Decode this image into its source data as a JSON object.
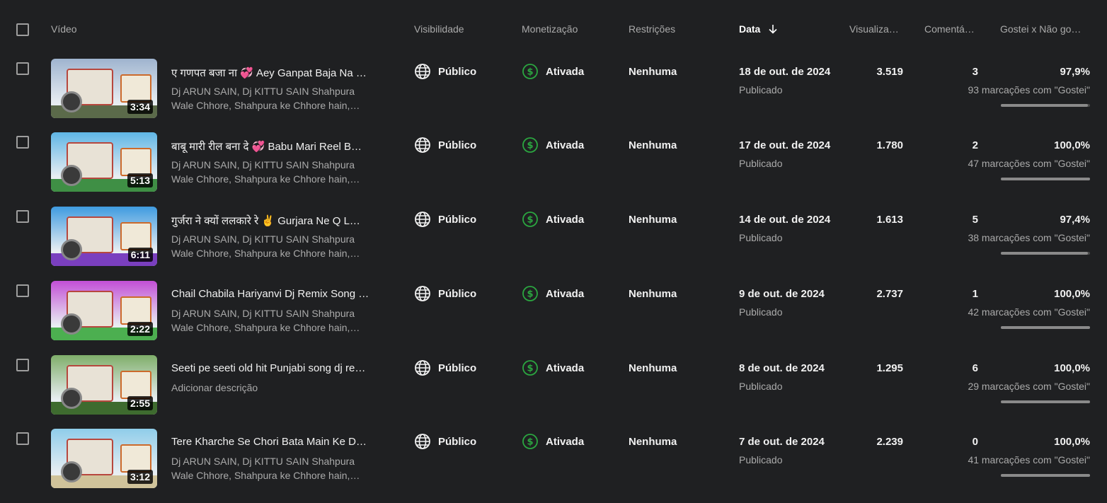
{
  "colors": {
    "background": "#1f2022",
    "text_primary": "#f1f1f1",
    "text_secondary": "#aaaaaa",
    "monetization_icon": "#2ba640"
  },
  "header": {
    "video": "Vídeo",
    "visibility": "Visibilidade",
    "monetization": "Monetização",
    "restrictions": "Restrições",
    "date": "Data",
    "views": "Visualiza…",
    "comments": "Comentá…",
    "likes": "Gostei x Não go…",
    "sort_icon": "arrow-down-icon"
  },
  "rows": [
    {
      "duration": "3:34",
      "title": "ए गणपत बजा ना 💞 Aey Ganpat Baja Na …",
      "desc1": "Dj ARUN SAIN, Dj KITTU SAIN Shahpura",
      "desc2": "Wale Chhore, Shahpura ke Chhore hain,…",
      "visibility": "Público",
      "monetization": "Ativada",
      "restrictions": "Nenhuma",
      "date": "18 de out. de 2024",
      "status": "Publicado",
      "views": "3.519",
      "comments": "3",
      "likes_pct": "97,9%",
      "likes_count": "93 marcações com \"Gostei\"",
      "like_ratio": 0.979,
      "thumb_sky": "#9fb4cf",
      "thumb_ground": "#5b6a4a"
    },
    {
      "duration": "5:13",
      "title": "बाबू मारी रील बना दे 💞 Babu Mari Reel B…",
      "desc1": "Dj ARUN SAIN, Dj KITTU SAIN Shahpura",
      "desc2": "Wale Chhore, Shahpura ke Chhore hain,…",
      "visibility": "Público",
      "monetization": "Ativada",
      "restrictions": "Nenhuma",
      "date": "17 de out. de 2024",
      "status": "Publicado",
      "views": "1.780",
      "comments": "2",
      "likes_pct": "100,0%",
      "likes_count": "47 marcações com \"Gostei\"",
      "like_ratio": 1.0,
      "thumb_sky": "#5fb6e6",
      "thumb_ground": "#3f8f45"
    },
    {
      "duration": "6:11",
      "title": "गुर्जरा ने क्यों ललकारे रे ✌️ Gurjara Ne Q L…",
      "desc1": "Dj ARUN SAIN, Dj KITTU SAIN Shahpura",
      "desc2": "Wale Chhore, Shahpura ke Chhore hain,…",
      "visibility": "Público",
      "monetization": "Ativada",
      "restrictions": "Nenhuma",
      "date": "14 de out. de 2024",
      "status": "Publicado",
      "views": "1.613",
      "comments": "5",
      "likes_pct": "97,4%",
      "likes_count": "38 marcações com \"Gostei\"",
      "like_ratio": 0.974,
      "thumb_sky": "#3f9be0",
      "thumb_ground": "#7a3fbf"
    },
    {
      "duration": "2:22",
      "title": "Chail Chabila Hariyanvi Dj Remix Song …",
      "desc1": "Dj ARUN SAIN, Dj KITTU SAIN Shahpura",
      "desc2": "Wale Chhore, Shahpura ke Chhore hain,…",
      "visibility": "Público",
      "monetization": "Ativada",
      "restrictions": "Nenhuma",
      "date": "9 de out. de 2024",
      "status": "Publicado",
      "views": "2.737",
      "comments": "1",
      "likes_pct": "100,0%",
      "likes_count": "42 marcações com \"Gostei\"",
      "like_ratio": 1.0,
      "thumb_sky": "#c24fd6",
      "thumb_ground": "#4caf50"
    },
    {
      "duration": "2:55",
      "title": "Seeti pe seeti old hit Punjabi song dj re…",
      "desc1": "Adicionar descrição",
      "desc2": "",
      "visibility": "Público",
      "monetization": "Ativada",
      "restrictions": "Nenhuma",
      "date": "8 de out. de 2024",
      "status": "Publicado",
      "views": "1.295",
      "comments": "6",
      "likes_pct": "100,0%",
      "likes_count": "29 marcações com \"Gostei\"",
      "like_ratio": 1.0,
      "thumb_sky": "#7fae6a",
      "thumb_ground": "#3e6b2f"
    },
    {
      "duration": "3:12",
      "title": "Tere Kharche Se Chori Bata Main Ke D…",
      "desc1": "Dj ARUN SAIN, Dj KITTU SAIN Shahpura",
      "desc2": "Wale Chhore, Shahpura ke Chhore hain,…",
      "visibility": "Público",
      "monetization": "Ativada",
      "restrictions": "Nenhuma",
      "date": "7 de out. de 2024",
      "status": "Publicado",
      "views": "2.239",
      "comments": "0",
      "likes_pct": "100,0%",
      "likes_count": "41 marcações com \"Gostei\"",
      "like_ratio": 1.0,
      "thumb_sky": "#8fcdea",
      "thumb_ground": "#d0c39a"
    }
  ]
}
